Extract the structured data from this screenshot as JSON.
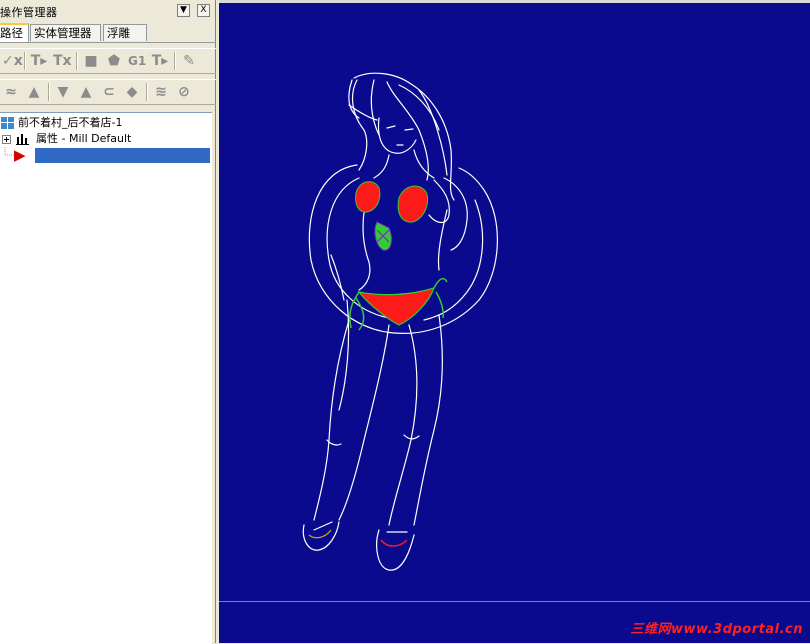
{
  "panel": {
    "title": "操作管理器",
    "pin_glyph": "▼",
    "close_glyph": "X"
  },
  "tabs": [
    {
      "label": "路径"
    },
    {
      "label": "实体管理器"
    },
    {
      "label": "浮雕"
    }
  ],
  "toolbar1": [
    "✓x",
    "T▸",
    "Tx",
    "■",
    "⬟",
    "G1",
    "T▸",
    "✎"
  ],
  "toolbar2": [
    "≈",
    "▲",
    "▼",
    "▲",
    "⊂",
    "◆",
    "≋",
    "⊘"
  ],
  "tree": {
    "root_label": "前不着村_后不着店-1",
    "properties_label": "属性 - Mill Default",
    "insert_marker": "▶"
  },
  "watermark": "三维网www.3dportal.cn",
  "colors": {
    "viewport_bg": "#0a0a8e",
    "wire": "#ffffff",
    "bikini": "#ff1a1a",
    "bikini_trim": "#33cc33",
    "accent": "#7a2bd0",
    "selection": "#316ac5"
  }
}
